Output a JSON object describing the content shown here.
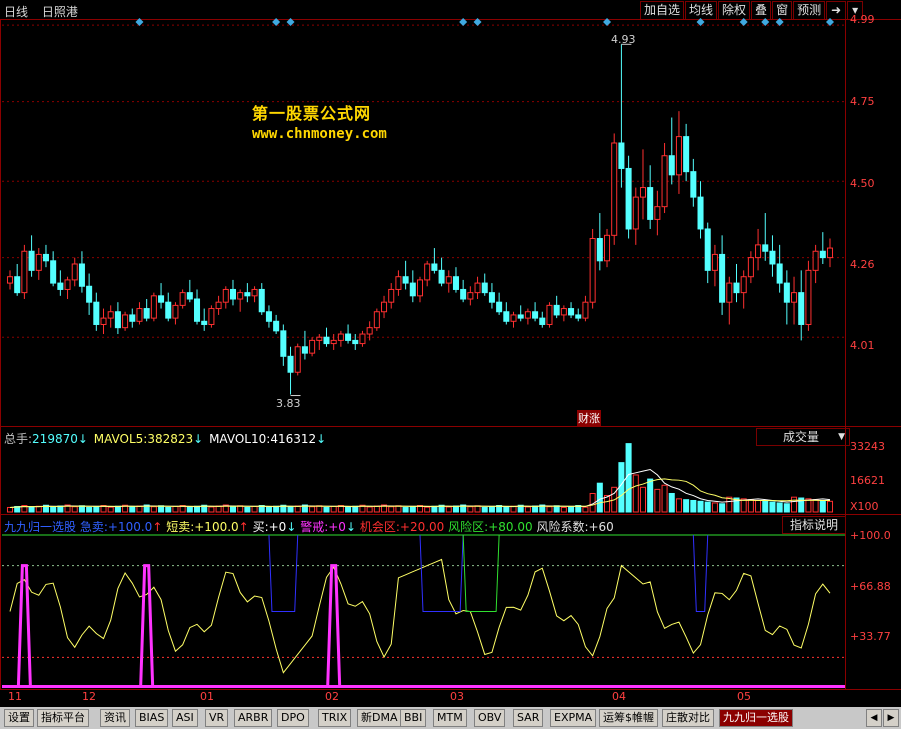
{
  "header": {
    "period": "日线",
    "stock_name": "日照港",
    "buttons": [
      "加自选",
      "均线",
      "除权",
      "叠",
      "窗",
      "预测"
    ]
  },
  "price_axis": [
    "4.99",
    "4.75",
    "4.50",
    "4.26",
    "4.01"
  ],
  "annotations": {
    "high": "4.93",
    "low": "3.83",
    "marker": "财涨"
  },
  "watermark": {
    "name": "第一股票公式网",
    "url": "www.chnmoney.com"
  },
  "volume": {
    "total_label": "总手:",
    "total_value": "219870",
    "ma5_label": "MAVOL5:",
    "ma5_value": "382823",
    "ma10_label": "MAVOL10:",
    "ma10_value": "416312",
    "down_arrow": "↓",
    "selector": "成交量",
    "axis": [
      "33243",
      "16621",
      "X100"
    ]
  },
  "indicator": {
    "name": "九九归一选股",
    "items": [
      {
        "label": "急卖:",
        "value": "+100.0",
        "arrow": "↑"
      },
      {
        "label": "短卖:",
        "value": "+100.0",
        "arrow": "↑"
      },
      {
        "label": "买:",
        "value": "+0",
        "arrow": "↓"
      },
      {
        "label": "警戒:",
        "value": "+0",
        "arrow": "↓"
      },
      {
        "label": "机会区:",
        "value": "+20.00",
        "arrow": ""
      },
      {
        "label": "风险区:",
        "value": "+80.00",
        "arrow": ""
      },
      {
        "label": "风险系数:",
        "value": "+60",
        "arrow": ""
      }
    ],
    "help_button": "指标说明",
    "axis": [
      "+100.0",
      "+66.88",
      "+33.77"
    ]
  },
  "months": [
    "11",
    "12",
    "01",
    "02",
    "03",
    "04",
    "05"
  ],
  "tabs": [
    "设置",
    "指标平台",
    "资讯",
    "BIAS",
    "ASI",
    "VR",
    "ARBR",
    "DPO",
    "TRIX",
    "新DMA",
    "BBI",
    "MTM",
    "OBV",
    "SAR",
    "EXPMA",
    "运筹$帷幄",
    "庄散对比",
    "九九归一选股"
  ],
  "active_tab": "九九归一选股",
  "colors": {
    "up": "#ff3030",
    "down": "#54ffff",
    "grid": "#8b0000",
    "diamond": "#3fa9e0",
    "ma5": "#ffffff",
    "ma10": "#ffff66",
    "ind_yellow": "#ffff66",
    "ind_magenta": "#ff33ff",
    "ind_blue": "#3030ff",
    "ind_green": "#30e030",
    "ind_dotted": "#8fc28f"
  },
  "chart_data": {
    "type": "candlestick",
    "y_range": [
      3.75,
      5.0
    ],
    "note_sessions": 137,
    "ohlc": [
      [
        4.18,
        4.22,
        4.16,
        4.2
      ],
      [
        4.2,
        4.24,
        4.14,
        4.15
      ],
      [
        4.15,
        4.3,
        4.13,
        4.28
      ],
      [
        4.28,
        4.33,
        4.2,
        4.22
      ],
      [
        4.22,
        4.29,
        4.19,
        4.27
      ],
      [
        4.27,
        4.3,
        4.23,
        4.25
      ],
      [
        4.25,
        4.28,
        4.17,
        4.18
      ],
      [
        4.18,
        4.22,
        4.14,
        4.16
      ],
      [
        4.16,
        4.2,
        4.13,
        4.19
      ],
      [
        4.19,
        4.26,
        4.17,
        4.24
      ],
      [
        4.24,
        4.28,
        4.15,
        4.17
      ],
      [
        4.17,
        4.21,
        4.08,
        4.12
      ],
      [
        4.12,
        4.15,
        4.03,
        4.05
      ],
      [
        4.05,
        4.1,
        4.02,
        4.07
      ],
      [
        4.07,
        4.11,
        4.04,
        4.09
      ],
      [
        4.09,
        4.12,
        4.02,
        4.04
      ],
      [
        4.04,
        4.09,
        4.03,
        4.08
      ],
      [
        4.08,
        4.1,
        4.04,
        4.06
      ],
      [
        4.06,
        4.12,
        4.05,
        4.1
      ],
      [
        4.1,
        4.13,
        4.06,
        4.07
      ],
      [
        4.07,
        4.15,
        4.06,
        4.14
      ],
      [
        4.14,
        4.18,
        4.1,
        4.12
      ],
      [
        4.12,
        4.15,
        4.06,
        4.07
      ],
      [
        4.07,
        4.12,
        4.05,
        4.11
      ],
      [
        4.11,
        4.16,
        4.1,
        4.15
      ],
      [
        4.15,
        4.19,
        4.12,
        4.13
      ],
      [
        4.13,
        4.16,
        4.05,
        4.06
      ],
      [
        4.06,
        4.1,
        4.03,
        4.05
      ],
      [
        4.05,
        4.11,
        4.04,
        4.1
      ],
      [
        4.1,
        4.14,
        4.08,
        4.12
      ],
      [
        4.12,
        4.17,
        4.1,
        4.16
      ],
      [
        4.16,
        4.19,
        4.11,
        4.13
      ],
      [
        4.13,
        4.16,
        4.09,
        4.15
      ],
      [
        4.15,
        4.18,
        4.12,
        4.14
      ],
      [
        4.14,
        4.17,
        4.12,
        4.16
      ],
      [
        4.16,
        4.18,
        4.08,
        4.09
      ],
      [
        4.09,
        4.11,
        4.04,
        4.06
      ],
      [
        4.06,
        4.08,
        4.02,
        4.03
      ],
      [
        4.03,
        4.05,
        3.92,
        3.95
      ],
      [
        3.95,
        3.98,
        3.83,
        3.9
      ],
      [
        3.9,
        3.99,
        3.89,
        3.98
      ],
      [
        3.98,
        4.03,
        3.94,
        3.96
      ],
      [
        3.96,
        4.01,
        3.95,
        4.0
      ],
      [
        4.0,
        4.02,
        3.97,
        4.01
      ],
      [
        4.01,
        4.04,
        3.98,
        3.99
      ],
      [
        3.99,
        4.02,
        3.97,
        4.0
      ],
      [
        4.0,
        4.03,
        3.98,
        4.02
      ],
      [
        4.02,
        4.05,
        3.99,
        4.0
      ],
      [
        4.0,
        4.02,
        3.97,
        3.99
      ],
      [
        3.99,
        4.03,
        3.98,
        4.02
      ],
      [
        4.02,
        4.06,
        4.0,
        4.04
      ],
      [
        4.04,
        4.1,
        4.03,
        4.09
      ],
      [
        4.09,
        4.14,
        4.07,
        4.12
      ],
      [
        4.12,
        4.18,
        4.1,
        4.16
      ],
      [
        4.16,
        4.22,
        4.14,
        4.2
      ],
      [
        4.2,
        4.25,
        4.16,
        4.18
      ],
      [
        4.18,
        4.22,
        4.12,
        4.14
      ],
      [
        4.14,
        4.2,
        4.12,
        4.19
      ],
      [
        4.19,
        4.25,
        4.17,
        4.24
      ],
      [
        4.24,
        4.29,
        4.21,
        4.22
      ],
      [
        4.22,
        4.26,
        4.17,
        4.18
      ],
      [
        4.18,
        4.22,
        4.15,
        4.2
      ],
      [
        4.2,
        4.23,
        4.15,
        4.16
      ],
      [
        4.16,
        4.19,
        4.12,
        4.13
      ],
      [
        4.13,
        4.17,
        4.11,
        4.15
      ],
      [
        4.15,
        4.2,
        4.13,
        4.18
      ],
      [
        4.18,
        4.21,
        4.14,
        4.15
      ],
      [
        4.15,
        4.18,
        4.1,
        4.12
      ],
      [
        4.12,
        4.15,
        4.08,
        4.09
      ],
      [
        4.09,
        4.12,
        4.05,
        4.06
      ],
      [
        4.06,
        4.09,
        4.04,
        4.08
      ],
      [
        4.08,
        4.11,
        4.06,
        4.07
      ],
      [
        4.07,
        4.1,
        4.05,
        4.09
      ],
      [
        4.09,
        4.12,
        4.06,
        4.07
      ],
      [
        4.07,
        4.09,
        4.04,
        4.05
      ],
      [
        4.05,
        4.12,
        4.04,
        4.11
      ],
      [
        4.11,
        4.14,
        4.07,
        4.08
      ],
      [
        4.08,
        4.11,
        4.06,
        4.1
      ],
      [
        4.1,
        4.12,
        4.07,
        4.08
      ],
      [
        4.08,
        4.1,
        4.06,
        4.07
      ],
      [
        4.07,
        4.14,
        4.06,
        4.12
      ],
      [
        4.12,
        4.35,
        4.1,
        4.32
      ],
      [
        4.32,
        4.4,
        4.22,
        4.25
      ],
      [
        4.25,
        4.35,
        4.23,
        4.33
      ],
      [
        4.33,
        4.65,
        4.3,
        4.62
      ],
      [
        4.62,
        4.93,
        4.48,
        4.54
      ],
      [
        4.54,
        4.58,
        4.32,
        4.35
      ],
      [
        4.35,
        4.48,
        4.3,
        4.45
      ],
      [
        4.45,
        4.6,
        4.38,
        4.48
      ],
      [
        4.48,
        4.55,
        4.35,
        4.38
      ],
      [
        4.38,
        4.47,
        4.33,
        4.42
      ],
      [
        4.42,
        4.62,
        4.4,
        4.58
      ],
      [
        4.58,
        4.7,
        4.49,
        4.52
      ],
      [
        4.52,
        4.72,
        4.46,
        4.64
      ],
      [
        4.64,
        4.68,
        4.5,
        4.53
      ],
      [
        4.53,
        4.57,
        4.42,
        4.45
      ],
      [
        4.45,
        4.5,
        4.32,
        4.35
      ],
      [
        4.35,
        4.37,
        4.18,
        4.22
      ],
      [
        4.22,
        4.3,
        4.17,
        4.27
      ],
      [
        4.27,
        4.33,
        4.08,
        4.12
      ],
      [
        4.12,
        4.2,
        4.05,
        4.18
      ],
      [
        4.18,
        4.24,
        4.12,
        4.15
      ],
      [
        4.15,
        4.22,
        4.1,
        4.2
      ],
      [
        4.2,
        4.28,
        4.18,
        4.26
      ],
      [
        4.26,
        4.35,
        4.22,
        4.3
      ],
      [
        4.3,
        4.4,
        4.25,
        4.28
      ],
      [
        4.28,
        4.33,
        4.2,
        4.24
      ],
      [
        4.24,
        4.3,
        4.15,
        4.18
      ],
      [
        4.18,
        4.22,
        4.05,
        4.12
      ],
      [
        4.12,
        4.2,
        4.05,
        4.15
      ],
      [
        4.15,
        4.22,
        4.0,
        4.05
      ],
      [
        4.05,
        4.25,
        4.03,
        4.22
      ],
      [
        4.22,
        4.3,
        4.18,
        4.28
      ],
      [
        4.28,
        4.34,
        4.24,
        4.26
      ],
      [
        4.26,
        4.32,
        4.23,
        4.29
      ]
    ]
  }
}
